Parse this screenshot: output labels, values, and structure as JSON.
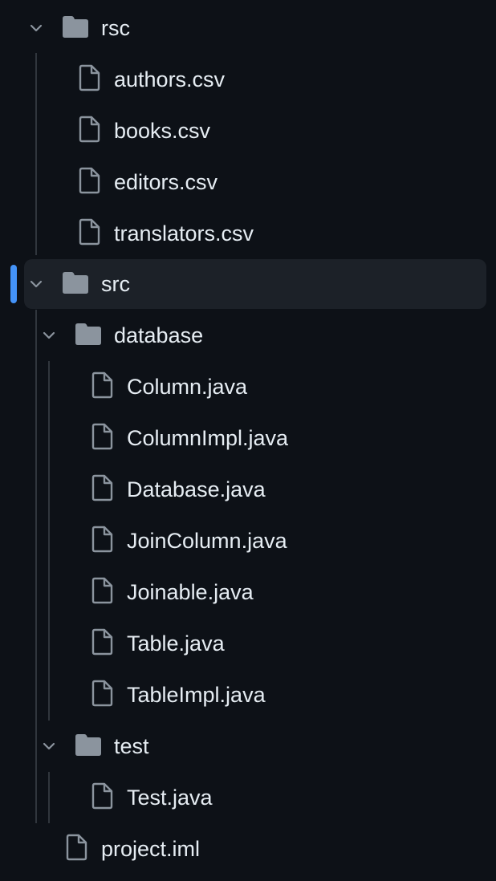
{
  "explorer": {
    "tree": [
      {
        "label": "rsc",
        "type": "folder",
        "expanded": true
      },
      {
        "label": "authors.csv",
        "type": "file"
      },
      {
        "label": "books.csv",
        "type": "file"
      },
      {
        "label": "editors.csv",
        "type": "file"
      },
      {
        "label": "translators.csv",
        "type": "file"
      },
      {
        "label": "src",
        "type": "folder",
        "expanded": true,
        "selected": true
      },
      {
        "label": "database",
        "type": "folder",
        "expanded": true
      },
      {
        "label": "Column.java",
        "type": "file"
      },
      {
        "label": "ColumnImpl.java",
        "type": "file"
      },
      {
        "label": "Database.java",
        "type": "file"
      },
      {
        "label": "JoinColumn.java",
        "type": "file"
      },
      {
        "label": "Joinable.java",
        "type": "file"
      },
      {
        "label": "Table.java",
        "type": "file"
      },
      {
        "label": "TableImpl.java",
        "type": "file"
      },
      {
        "label": "test",
        "type": "folder",
        "expanded": true
      },
      {
        "label": "Test.java",
        "type": "file"
      },
      {
        "label": "project.iml",
        "type": "file"
      }
    ],
    "icons": {
      "folder": "folder-icon",
      "file": "file-icon",
      "chevron": "chevron-down-icon"
    },
    "colors": {
      "background": "#0d1117",
      "selected_row": "#1c2128",
      "selection_indicator": "#4493f8",
      "text": "#e6edf3",
      "icon": "#8b949e"
    }
  }
}
